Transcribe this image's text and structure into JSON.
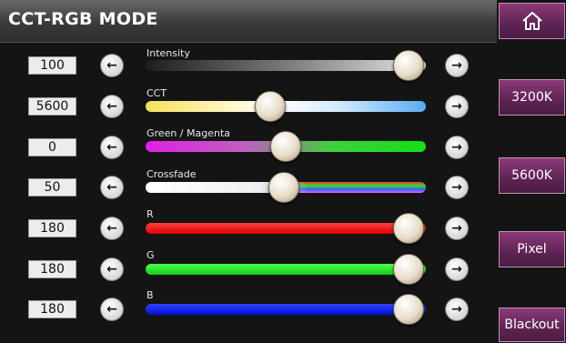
{
  "header": {
    "title": "CCT-RGB MODE"
  },
  "sidebar": {
    "home_icon": "home-icon",
    "buttons": [
      "3200K",
      "5600K",
      "Pixel",
      "Blackout"
    ],
    "accent": "#5e2453"
  },
  "rows": [
    {
      "value": "100",
      "label": "Intensity",
      "level": 0.93
    },
    {
      "value": "5600",
      "label": "CCT",
      "level": 0.45
    },
    {
      "value": "0",
      "label": "Green / Magenta",
      "level": 0.5
    },
    {
      "value": "50",
      "label": "Crossfade",
      "level": 0.48
    },
    {
      "value": "180",
      "label": "R",
      "level": 0.93
    },
    {
      "value": "180",
      "label": "G",
      "level": 0.93
    },
    {
      "value": "180",
      "label": "B",
      "level": 0.93
    }
  ],
  "icons": {
    "left": "arrow-left-icon",
    "right": "arrow-right-icon"
  }
}
